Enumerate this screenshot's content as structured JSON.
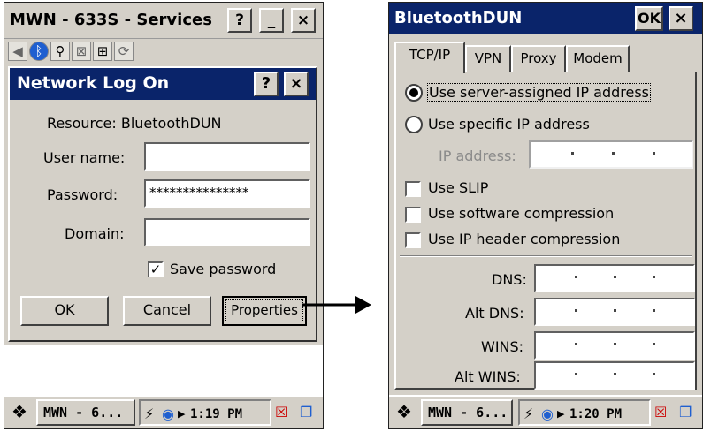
{
  "left": {
    "window_title": "MWN - 633S - Services",
    "help_label": "?",
    "min_label": "_",
    "close_label": "×",
    "dialog": {
      "title": "Network Log On",
      "help_label": "?",
      "close_label": "×",
      "resource": "Resource: BluetoothDUN",
      "user_name_label": "User name:",
      "user_name_value": "",
      "password_label": "Password:",
      "password_value": "***************",
      "domain_label": "Domain:",
      "domain_value": "",
      "save_password_label": "Save password",
      "save_password_checked": true,
      "ok_label": "OK",
      "cancel_label": "Cancel",
      "properties_label": "Properties"
    },
    "taskbar": {
      "task_label": "MWN - 6...",
      "clock": "1:19 PM"
    }
  },
  "right": {
    "window_title": "BluetoothDUN",
    "ok_label": "OK",
    "close_label": "×",
    "tabs": [
      "TCP/IP",
      "VPN",
      "Proxy",
      "Modem"
    ],
    "active_tab": "TCP/IP",
    "radio_server": "Use server-assigned IP address",
    "radio_specific": "Use specific IP address",
    "ip_address_label": "IP address:",
    "use_slip": "Use SLIP",
    "use_sw_compression": "Use software compression",
    "use_ip_header_compression": "Use IP header compression",
    "dns_label": "DNS:",
    "alt_dns_label": "Alt DNS:",
    "wins_label": "WINS:",
    "alt_wins_label": "Alt WINS:",
    "taskbar": {
      "task_label": "MWN - 6...",
      "clock": "1:20 PM"
    }
  },
  "colors": {
    "title_active": "#0a246a",
    "face": "#d4d0c8",
    "arrow": "#000000"
  }
}
